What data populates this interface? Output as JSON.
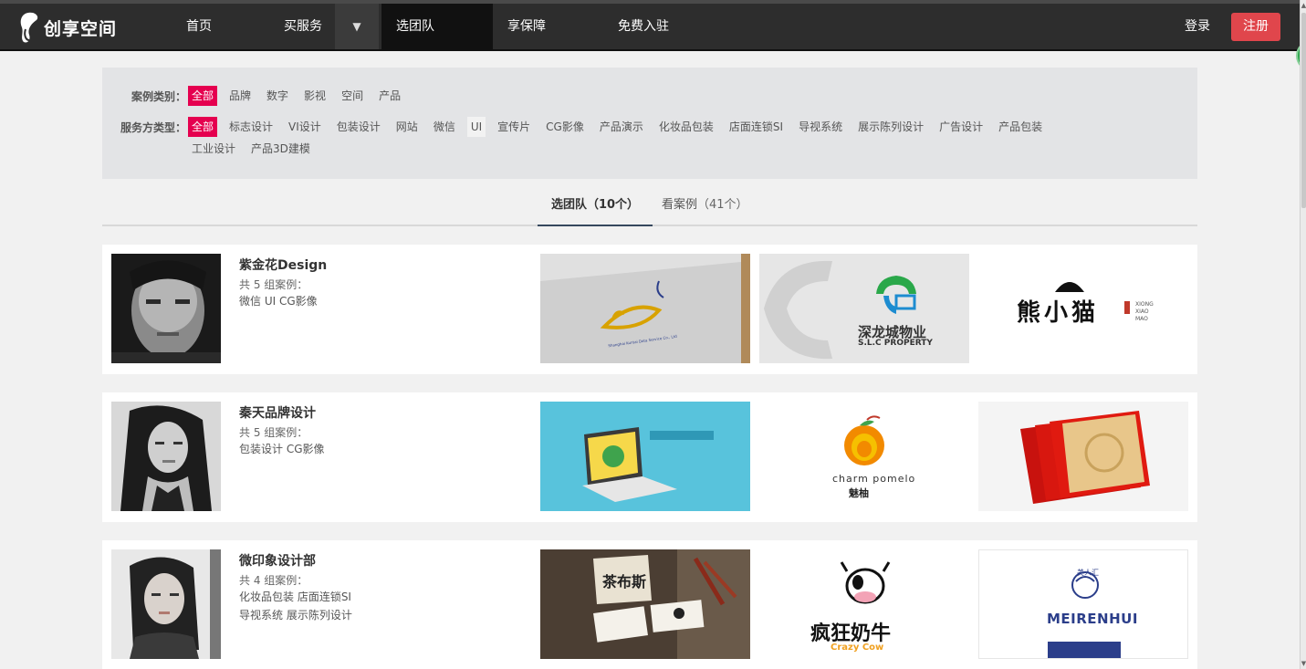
{
  "brand": {
    "name": "创享空间",
    "accent": "#e5004f"
  },
  "nav": {
    "items": [
      "首页",
      "买服务",
      "选团队",
      "享保障",
      "免费入驻"
    ],
    "dropdown_arrow": "▼",
    "login": "登录",
    "register": "注册"
  },
  "filters": {
    "case_label": "案例类别：",
    "case_options": [
      "全部",
      "品牌",
      "数字",
      "影视",
      "空间",
      "产品"
    ],
    "service_label": "服务方类型：",
    "service_options": [
      "全部",
      "标志设计",
      "VI设计",
      "包装设计",
      "网站",
      "微信",
      "UI",
      "宣传片",
      "CG影像",
      "产品演示",
      "化妆品包装",
      "店面连锁SI",
      "导视系统",
      "展示陈列设计",
      "广告设计",
      "产品包装",
      "工业设计",
      "产品3D建模"
    ]
  },
  "tabs": [
    {
      "label": "选团队",
      "count": "（10个）"
    },
    {
      "label": "看案例",
      "count": "（41个）"
    }
  ],
  "teams": [
    {
      "name": "紫金花Design",
      "count": "共 5 组案例：",
      "services": [
        "微信 UI CG影像"
      ],
      "thumbs": [
        {
          "caption": "Shanghai Kuntai Data Service Co., Ltd"
        },
        {
          "title": "深龙城物业",
          "subtitle": "S.L.C PROPERTY"
        },
        {
          "title": "熊小猫",
          "subtitle": "XIONG XIAO MAO"
        }
      ]
    },
    {
      "name": "秦天品牌设计",
      "count": "共 5 组案例：",
      "services": [
        "包装设计 CG影像"
      ],
      "thumbs": [
        {
          "caption": ""
        },
        {
          "title": "charm pomelo",
          "subtitle": "魅柚"
        },
        {
          "caption": ""
        }
      ]
    },
    {
      "name": "微印象设计部",
      "count": "共 4 组案例：",
      "services": [
        "化妆品包装 店面连锁SI",
        "导视系统 展示陈列设计"
      ],
      "thumbs": [
        {
          "title": "茶布斯"
        },
        {
          "title": "疯狂奶牛",
          "subtitle": "Crazy Cow"
        },
        {
          "title": "MEIRENHUI",
          "subtitle": "美人汇"
        }
      ]
    }
  ]
}
